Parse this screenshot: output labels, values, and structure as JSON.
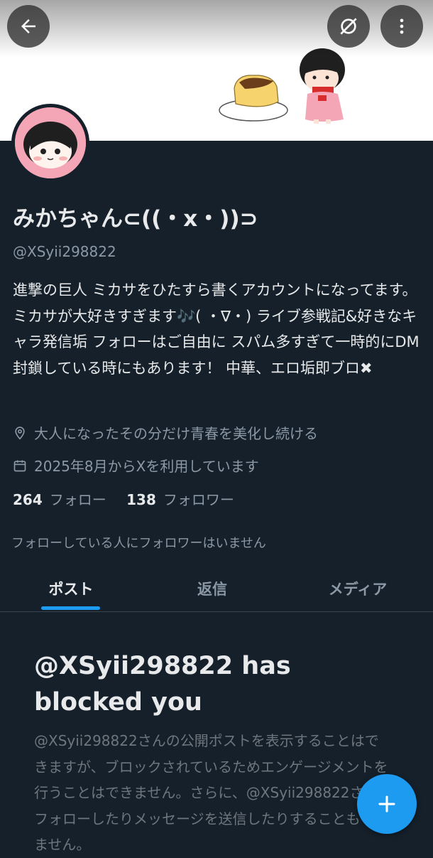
{
  "profile": {
    "display_name": "みかちゃん⊂((・x・))⊃",
    "handle": "@XSyii298822",
    "bio": "進撃の巨人 ミカサをひたすら書くアカウントになってます。 ミカサが大好きすぎます🎶( ・∇・) ライブ参戦記&好きなキャラ発信垢 フォローはご自由に スパム多すぎて一時的にDM封鎖している時にもあります！ 中華、エロ垢即ブロ✖",
    "location": "大人になったその分だけ青春を美化し続ける",
    "joined": "2025年8月からXを利用しています",
    "following_count": "264",
    "following_label": "フォロー",
    "followers_count": "138",
    "followers_label": "フォロワー",
    "followers_you_know": "フォローしている人にフォロワーはいません"
  },
  "top_icons": {
    "back": "arrow-left-icon",
    "unmute": "no-eye-icon",
    "more": "more-vertical-icon"
  },
  "tabs": [
    {
      "label": "ポスト",
      "active": true
    },
    {
      "label": "返信",
      "active": false
    },
    {
      "label": "メディア",
      "active": false
    }
  ],
  "blocked": {
    "title": "@XSyii298822 has blocked you",
    "message": "@XSyii298822さんの公開ポストを表示することはできますが、ブロックされているためエンゲージメントを行うことはできません。さらに、@XSyii298822さんをフォローしたりメッセージを送信したりすることもできません。"
  },
  "fab": {
    "icon": "plus-icon"
  },
  "colors": {
    "background": "#15202b",
    "accent": "#1d9bf0",
    "text_primary": "#e7e9ea",
    "text_secondary": "#8b98a5",
    "avatar_ring": "#f4a6b6"
  }
}
